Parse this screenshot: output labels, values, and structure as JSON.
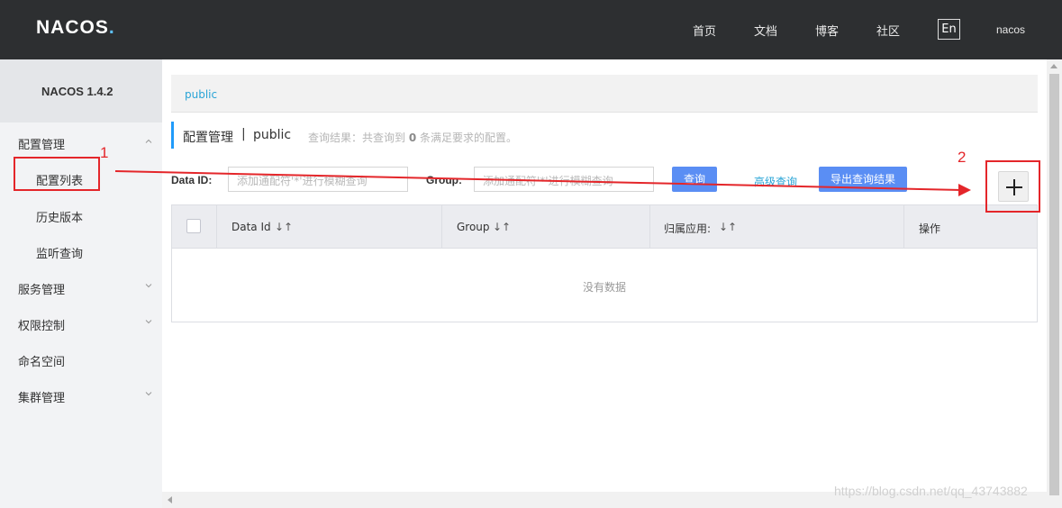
{
  "header": {
    "logo_text": "NACOS",
    "logo_dot": ".",
    "nav": [
      {
        "label": "首页"
      },
      {
        "label": "文档"
      },
      {
        "label": "博客"
      },
      {
        "label": "社区"
      }
    ],
    "lang_button": "En",
    "user": "nacos"
  },
  "sidebar": {
    "version_title": "NACOS 1.4.2",
    "groups": [
      {
        "label": "配置管理",
        "expanded": true,
        "items": [
          {
            "label": "配置列表"
          },
          {
            "label": "历史版本"
          },
          {
            "label": "监听查询"
          }
        ]
      },
      {
        "label": "服务管理",
        "expanded": false
      },
      {
        "label": "权限控制",
        "expanded": false
      },
      {
        "label": "命名空间"
      },
      {
        "label": "集群管理",
        "expanded": false
      }
    ]
  },
  "main": {
    "namespace_tab": "public",
    "page_title": "配置管理",
    "page_separator": "|",
    "page_namespace": "public",
    "result_prefix": "查询结果：共查询到",
    "result_count": "0",
    "result_suffix": "条满足要求的配置。",
    "filters": {
      "data_id_label": "Data ID:",
      "data_id_placeholder": "添加通配符'*'进行模糊查询",
      "group_label": "Group:",
      "group_placeholder": "添加通配符'*'进行模糊查询"
    },
    "search_button": "查询",
    "advanced_query_link": "高级查询",
    "export_button": "导出查询结果",
    "add_button_icon": "plus-icon",
    "table": {
      "columns": [
        {
          "label": "Data Id",
          "sortable": true
        },
        {
          "label": "Group",
          "sortable": true
        },
        {
          "label": "归属应用:",
          "sortable": true
        },
        {
          "label": "操作",
          "sortable": false
        }
      ],
      "sort_glyph": "↓↑",
      "empty_text": "没有数据"
    }
  },
  "annotations": {
    "label_1": "1",
    "label_2": "2",
    "color": "#e4262a"
  },
  "watermark": "https://blog.csdn.net/qq_43743882"
}
